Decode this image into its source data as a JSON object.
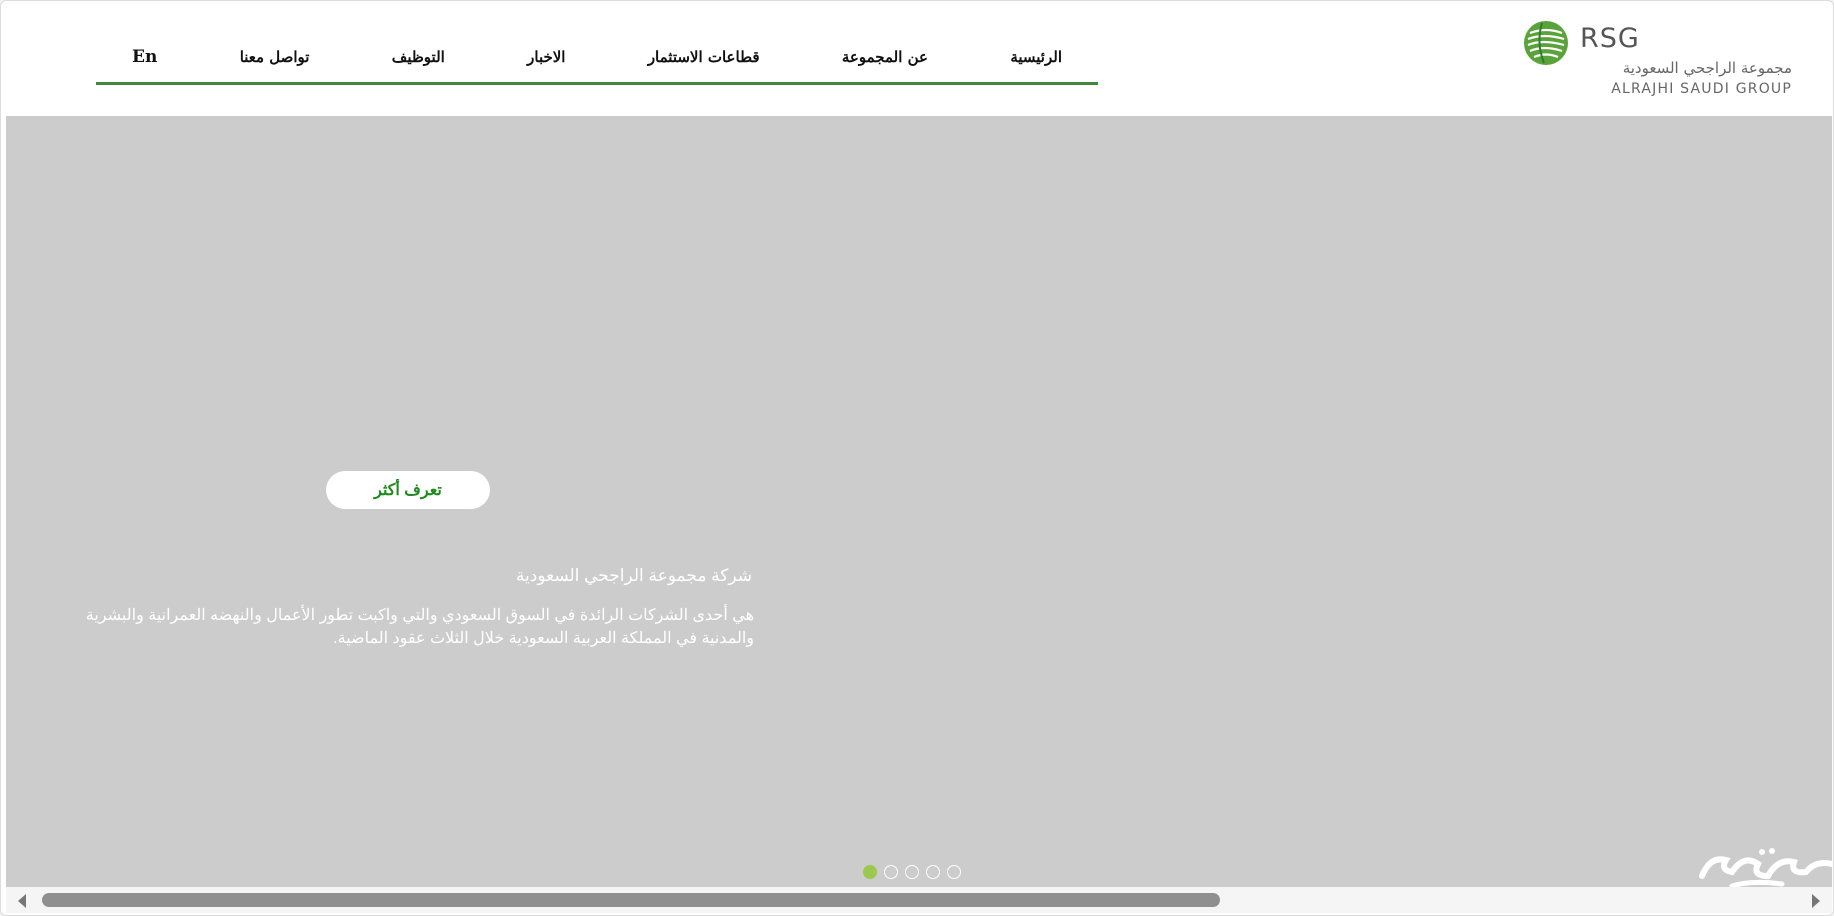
{
  "nav": {
    "items": [
      {
        "label": "الرئيسية"
      },
      {
        "label": "عن المجموعة"
      },
      {
        "label": "قطاعات الاستثمار"
      },
      {
        "label": "الاخبار"
      },
      {
        "label": "التوظيف"
      },
      {
        "label": "تواصل معنا"
      }
    ],
    "lang_label": "En",
    "accent_color": "#3f8a3c"
  },
  "logo": {
    "acronym": "RSG",
    "name_ar": "مجموعة الراجحي السعودية",
    "name_en": "ALRAJHI SAUDI GROUP",
    "icon": "rsg-logo-mark",
    "color": "#5aa33a"
  },
  "hero": {
    "cta_label": "تعرف أكثر",
    "title": "شركة مجموعة الراجحي السعودية",
    "description": "هي أحدى الشركات الرائدة في السوق السعودي والتي واكبت تطور الأعمال والنهضه العمرانية والبشرية والمدنية في المملكة العربية السعودية خلال الثلاث عقود الماضية.",
    "background_color": "#cccccc",
    "cta_color": "#1d8a1d"
  },
  "carousel": {
    "slide_count": 5,
    "active_index": 0,
    "active_color": "#9cc84f"
  },
  "scrollbar": {
    "thumb_color": "#8f8f8f"
  }
}
